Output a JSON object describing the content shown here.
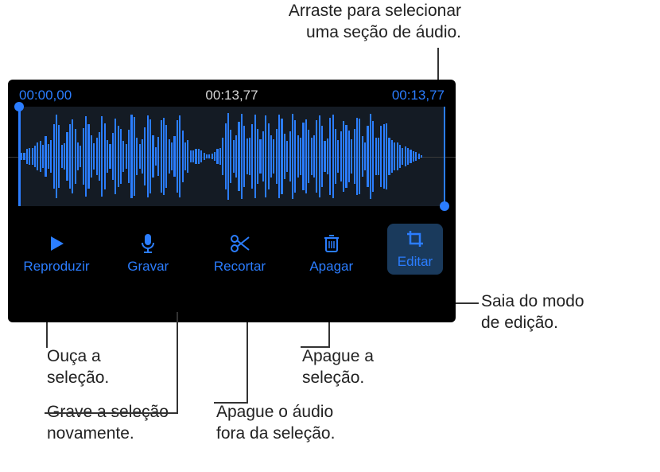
{
  "callouts": {
    "top": "Arraste para selecionar\numa seção de áudio.",
    "right": "Saia do modo\nde edição.",
    "play": "Ouça a\nseleção.",
    "record": "Grave a seleção\nnovamente.",
    "trim": "Apague o áudio\nfora da seleção.",
    "delete": "Apague a\nseleção."
  },
  "timecodes": {
    "start": "00:00,00",
    "playhead": "00:13,77",
    "end": "00:13,77"
  },
  "toolbar": {
    "play": "Reproduzir",
    "record": "Gravar",
    "trim": "Recortar",
    "delete": "Apagar",
    "edit": "Editar"
  }
}
